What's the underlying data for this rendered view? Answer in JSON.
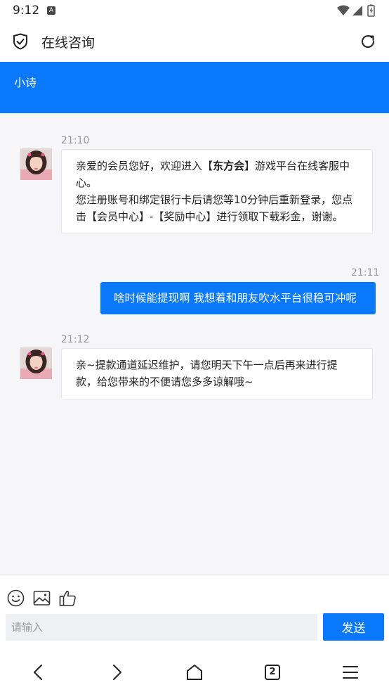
{
  "status_bar": {
    "time": "9:12",
    "notification_glyph": "A"
  },
  "app_bar": {
    "title": "在线咨询",
    "icons": [
      "shield-check-icon",
      "reload-icon"
    ]
  },
  "agent": {
    "name": "小诗"
  },
  "messages": [
    {
      "direction": "incoming",
      "time": "21:10",
      "lines": [
        "亲爱的会员您好，欢迎进入【东方会】游戏平台在线客服中心。",
        "您注册账号和绑定银行卡后请您等10分钟后重新登录，您点击【会员中心】-【奖励中心】进行领取下载彩金，谢谢。"
      ],
      "bold_fragment": "东方会"
    },
    {
      "direction": "outgoing",
      "time": "21:11",
      "text": "啥时候能提现啊 我想着和朋友吹水平台很稳可冲呢"
    },
    {
      "direction": "incoming",
      "time": "21:12",
      "lines": [
        "亲~提款通道延迟维护，请您明天下午一点后再来进行提款，给您带来的不便请您多多谅解哦~"
      ]
    }
  ],
  "composer": {
    "placeholder": "请输入",
    "value": "",
    "send_label": "发送",
    "tools": [
      "emoji-icon",
      "image-icon",
      "thumbs-up-icon"
    ]
  },
  "bottom_nav": {
    "tab_count": "2",
    "icons": [
      "back-icon",
      "forward-icon",
      "home-icon",
      "tabs-icon",
      "menu-icon"
    ]
  },
  "colors": {
    "accent": "#0a78fa",
    "page_bg": "#f6f6f8"
  }
}
